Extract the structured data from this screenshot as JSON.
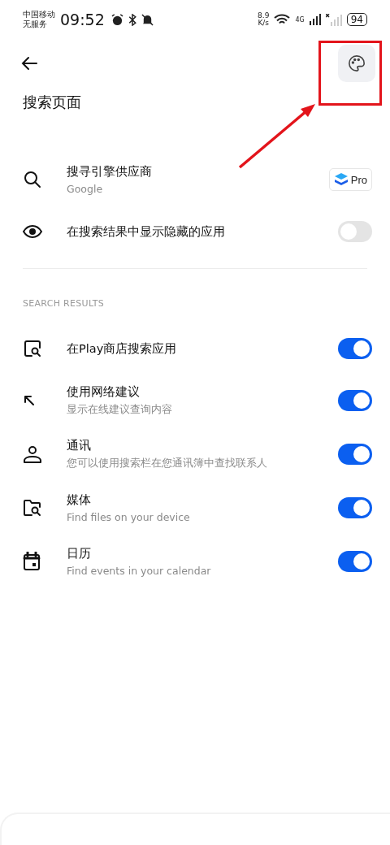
{
  "status_bar": {
    "carrier": [
      "中国移动",
      "无服务"
    ],
    "time": "09:52",
    "speed": [
      "8.9",
      "K/s"
    ],
    "network": "4G",
    "battery": "94"
  },
  "header": {
    "title": "搜索页面"
  },
  "general": [
    {
      "kind": "pro",
      "title": "搜寻引擎供应商",
      "subtitle": "Google",
      "badge": "Pro"
    },
    {
      "kind": "toggle",
      "title": "在搜索结果中显示隐藏的应用",
      "on": false
    }
  ],
  "section": {
    "title": "SEARCH RESULTS",
    "items": [
      {
        "kind": "toggle",
        "title": "在Play商店搜索应用",
        "on": true
      },
      {
        "kind": "toggle",
        "title": "使用网络建议",
        "subtitle": "显示在线建议查询内容",
        "on": true
      },
      {
        "kind": "toggle",
        "title": "通讯",
        "subtitle": "您可以使用搜索栏在您通讯簿中查找联系人",
        "on": true
      },
      {
        "kind": "toggle",
        "title": "媒体",
        "subtitle": "Find files on your device",
        "on": true
      },
      {
        "kind": "toggle",
        "title": "日历",
        "subtitle": "Find events in your calendar",
        "on": true
      }
    ]
  }
}
